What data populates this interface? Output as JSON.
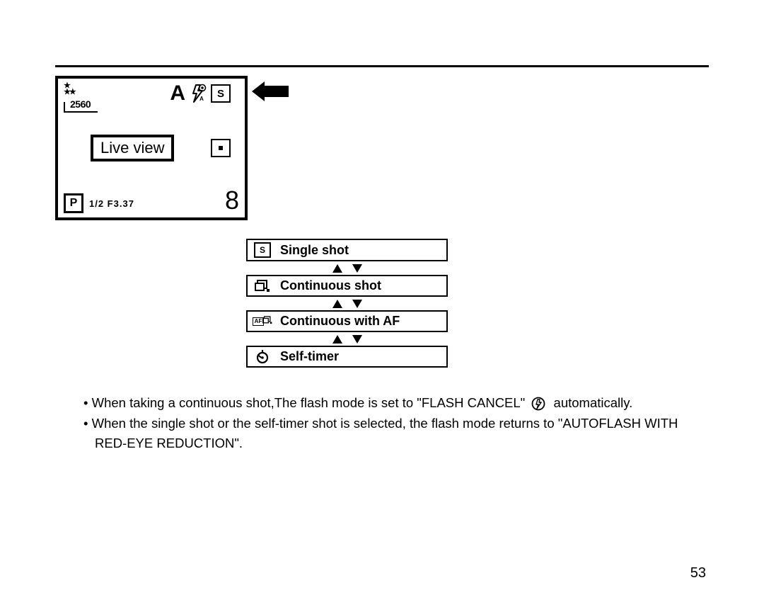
{
  "lcd": {
    "size_label": "2560",
    "mode_letter": "A",
    "drive_icon_letter": "S",
    "liveview_label": "Live view",
    "program_letter": "P",
    "exposure_text": "1/2 F3.37",
    "frames_remaining": "8"
  },
  "modes": {
    "single": {
      "icon_letter": "S",
      "label": "Single shot"
    },
    "continuous": {
      "label": "Continuous shot"
    },
    "continuous_af": {
      "af_text": "AF",
      "label": "Continuous with AF"
    },
    "self_timer": {
      "label": "Self-timer"
    }
  },
  "notes": {
    "item1_pre": "When taking a continuous shot,The flash mode is set to \"FLASH CANCEL\"",
    "item1_post": "automatically.",
    "item2": "When the single shot or the self-timer shot is selected, the flash mode returns to \"AUTOFLASH WITH RED-EYE REDUCTION\"."
  },
  "page_number": "53"
}
